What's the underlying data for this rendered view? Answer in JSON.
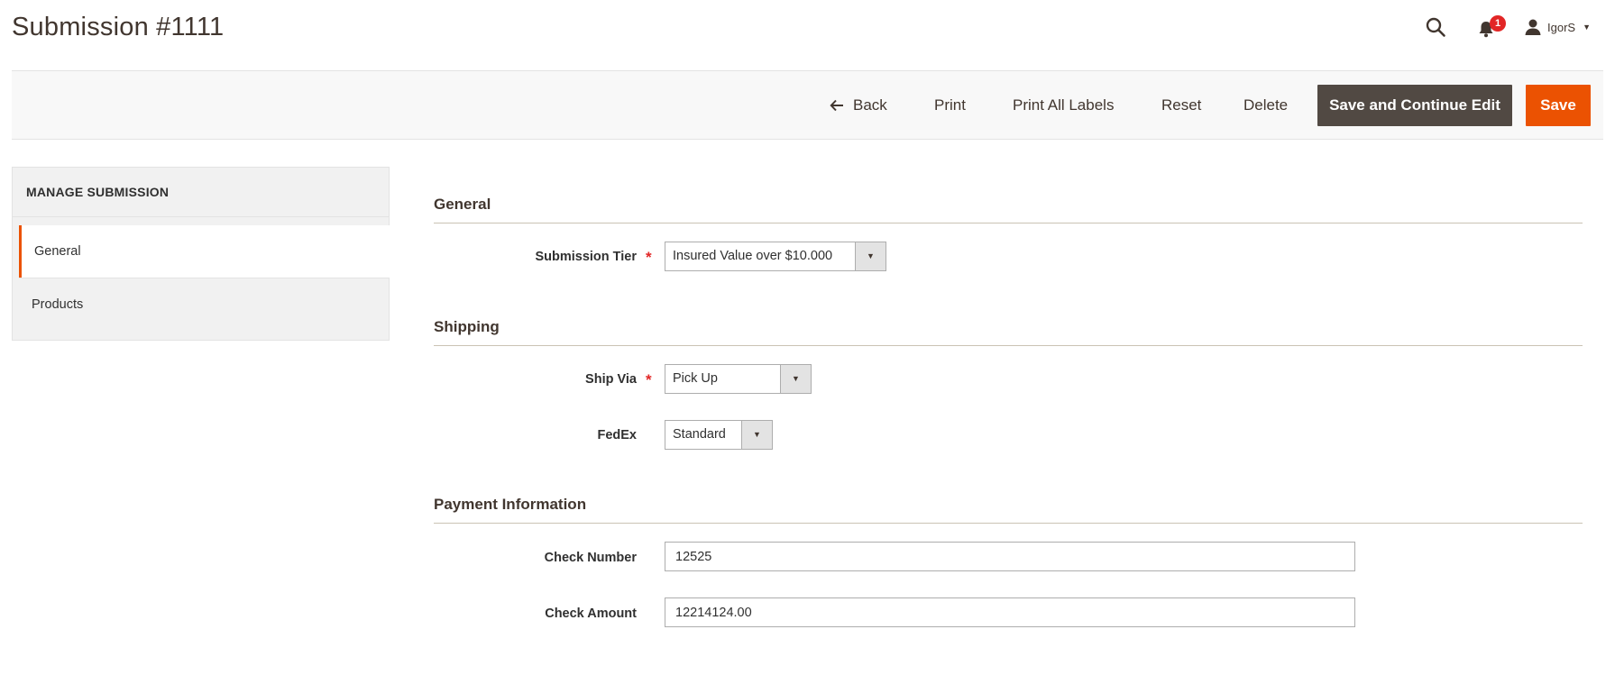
{
  "header": {
    "title": "Submission #1111",
    "notifications_count": "1",
    "username": "IgorS",
    "icons": {
      "search": "search-icon",
      "notifications": "bell-icon",
      "user": "user-icon"
    }
  },
  "actions": {
    "back": "Back",
    "print": "Print",
    "print_all_labels": "Print All Labels",
    "reset": "Reset",
    "delete": "Delete",
    "save_continue": "Save and Continue Edit",
    "save": "Save"
  },
  "sidebar": {
    "title": "MANAGE SUBMISSION",
    "items": [
      {
        "label": "General",
        "active": true
      },
      {
        "label": "Products",
        "active": false
      }
    ]
  },
  "sections": {
    "general": {
      "title": "General",
      "submission_tier_label": "Submission Tier",
      "submission_tier_value": "Insured Value over $10.000"
    },
    "shipping": {
      "title": "Shipping",
      "ship_via_label": "Ship Via",
      "ship_via_value": "Pick Up",
      "fedex_label": "FedEx",
      "fedex_value": "Standard"
    },
    "payment": {
      "title": "Payment Information",
      "check_number_label": "Check Number",
      "check_number_value": "12525",
      "check_amount_label": "Check Amount",
      "check_amount_value": "12214124.00"
    }
  },
  "colors": {
    "accent": "#eb5202",
    "secondary_button": "#514943",
    "badge": "#e22626",
    "required": "#e22626"
  }
}
